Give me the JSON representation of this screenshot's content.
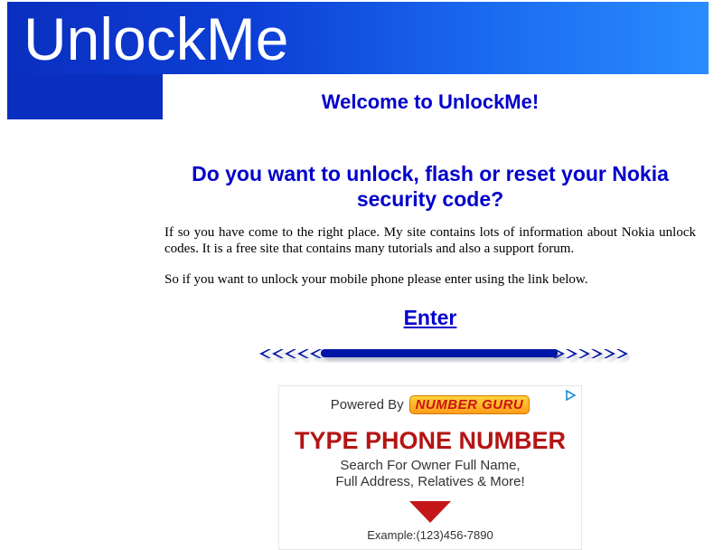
{
  "header": {
    "site_title": "UnlockMe"
  },
  "main": {
    "welcome": "Welcome to UnlockMe!",
    "question": "Do you want to unlock, flash or reset your Nokia security code?",
    "paragraph1": "If so you have come to the right place. My site contains lots of information about Nokia unlock codes. It is a free site that contains many tutorials and also a support forum.",
    "paragraph2": "So if you want to unlock your mobile phone please enter using the link below.",
    "enter_link": "Enter"
  },
  "ad": {
    "powered_by": "Powered By",
    "logo_text": "NUMBER GURU",
    "headline": "TYPE PHONE NUMBER",
    "line1": "Search For Owner Full Name,",
    "line2": "Full Address, Relatives & More!",
    "example": "Example:(123)456-7890",
    "choices_icon": "adchoices-icon"
  },
  "colors": {
    "banner": "#0a2fbf",
    "heading_blue": "#0000cc",
    "ad_red": "#b51414"
  }
}
